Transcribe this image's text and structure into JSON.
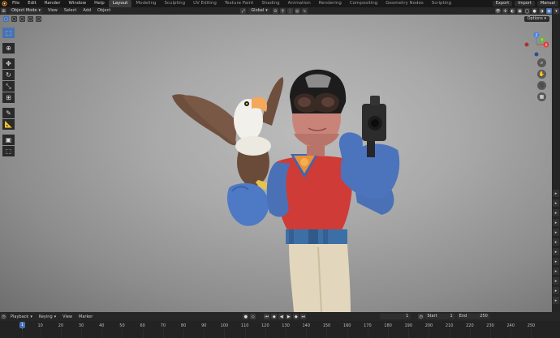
{
  "menu": {
    "items": [
      "File",
      "Edit",
      "Render",
      "Window",
      "Help"
    ],
    "workspaces": [
      "Layout",
      "Modeling",
      "Sculpting",
      "UV Editing",
      "Texture Paint",
      "Shading",
      "Animation",
      "Rendering",
      "Compositing",
      "Geometry Nodes",
      "Scripting"
    ],
    "active_workspace": "Layout",
    "export_label": "Export",
    "import_label": "Import",
    "manual_label": "Manual"
  },
  "header": {
    "mode": "Object Mode",
    "view": "View",
    "select": "Select",
    "add": "Add",
    "object": "Object",
    "orientation": "Global",
    "options": "Options"
  },
  "gizmo": {
    "x": "X",
    "y": "Y",
    "z": "Z"
  },
  "timeline": {
    "playback": "Playback",
    "keying": "Keying",
    "view": "View",
    "marker": "Marker",
    "current_frame": "1",
    "start_label": "Start",
    "start": "1",
    "end_label": "End",
    "end": "250",
    "ruler": [
      "1",
      "10",
      "20",
      "30",
      "40",
      "50",
      "60",
      "70",
      "80",
      "90",
      "100",
      "110",
      "120",
      "130",
      "140",
      "150",
      "160",
      "170",
      "180",
      "190",
      "200",
      "210",
      "220",
      "230",
      "240",
      "250"
    ]
  },
  "colors": {
    "accent": "#4772b3",
    "x_axis": "#e03c3c",
    "y_axis": "#6bb33c",
    "z_axis": "#4a7fe0"
  }
}
